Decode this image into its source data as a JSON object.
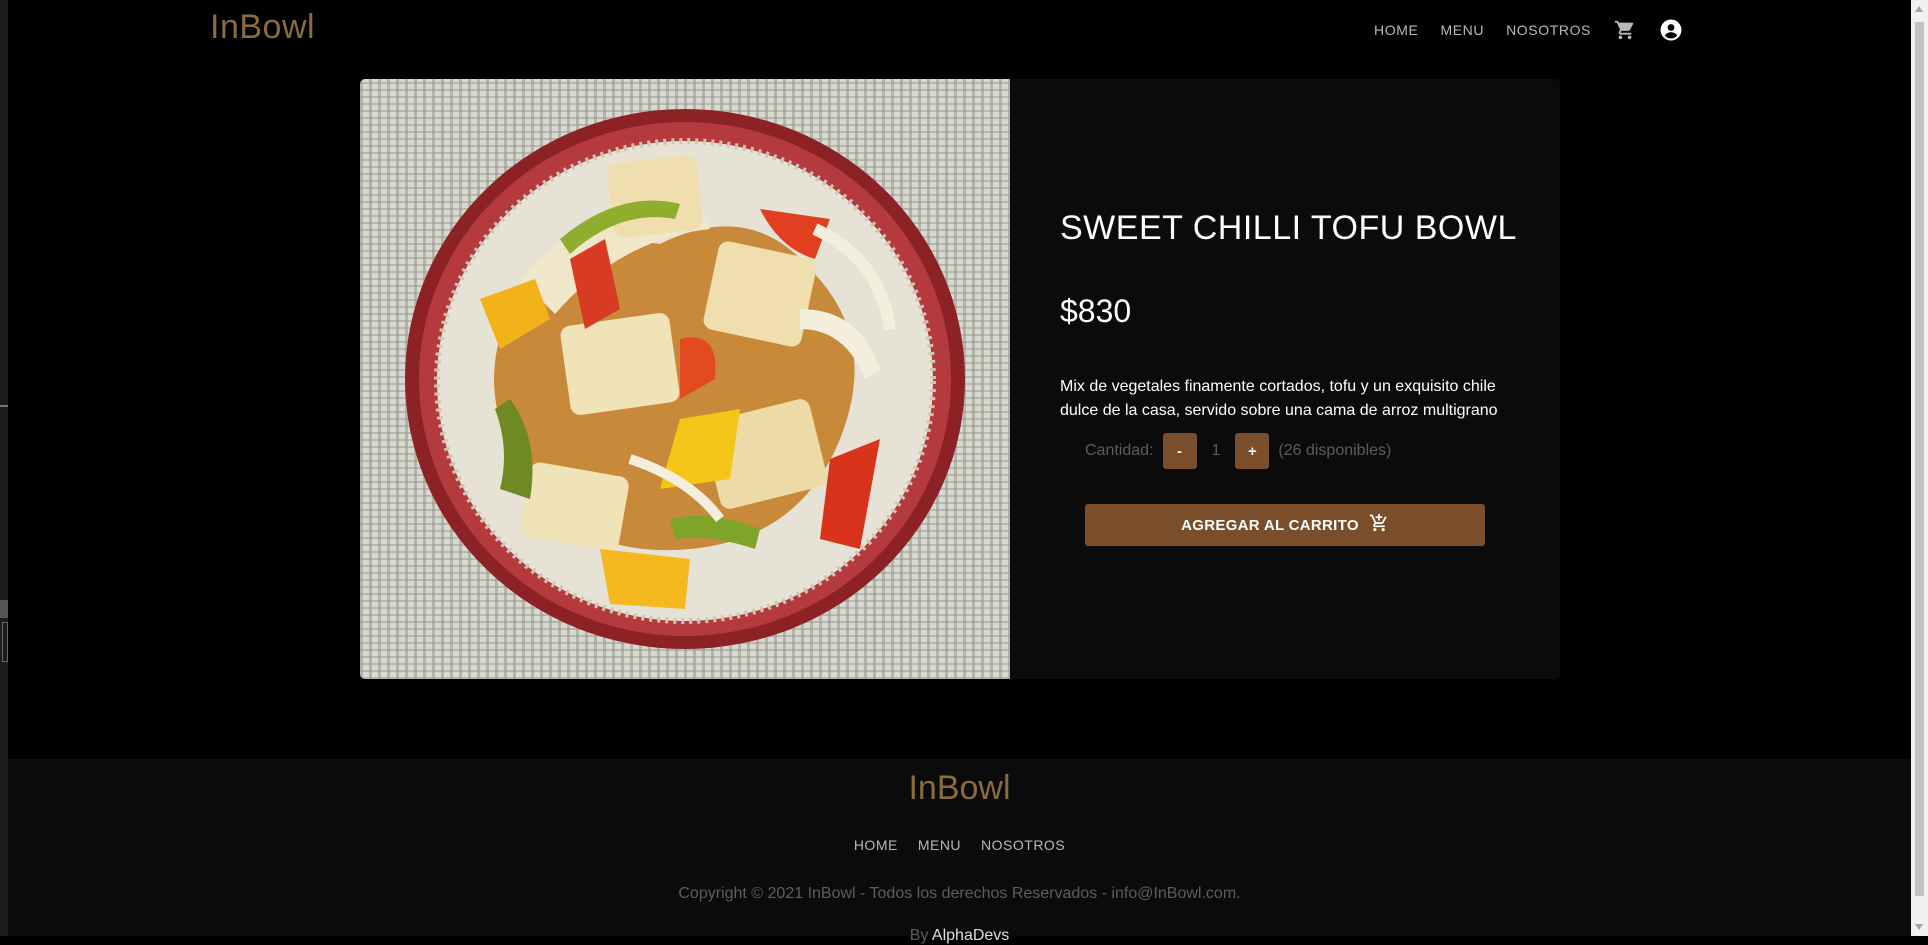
{
  "nav": {
    "brand": "InBowl",
    "links": [
      "HOME",
      "MENU",
      "NOSOTROS"
    ],
    "icons": [
      "cart-icon",
      "account-circle-icon"
    ]
  },
  "product": {
    "title": "SWEET CHILLI TOFU BOWL",
    "price": "$830",
    "description": "Mix de vegetales finamente cortados, tofu y un exquisito chile dulce de la casa, servido sobre una cama de arroz multigrano",
    "quantity_label": "Cantidad:",
    "decrement_label": "-",
    "quantity": "1",
    "increment_label": "+",
    "available": "(26 disponibles)",
    "add_to_cart_label": "AGREGAR AL CARRITO"
  },
  "footer": {
    "brand": "InBowl",
    "links": [
      "HOME",
      "MENU",
      "NOSOTROS"
    ],
    "copyright": "Copyright © 2021 InBowl - Todos los derechos Reservados - info@InBowl.com.",
    "by_prefix": "By",
    "by_author": "AlphaDevs"
  },
  "colors": {
    "accent": "#7a4e2a",
    "brand": "#8a6b3c",
    "background": "#000000",
    "card": "#0b0b0b"
  }
}
